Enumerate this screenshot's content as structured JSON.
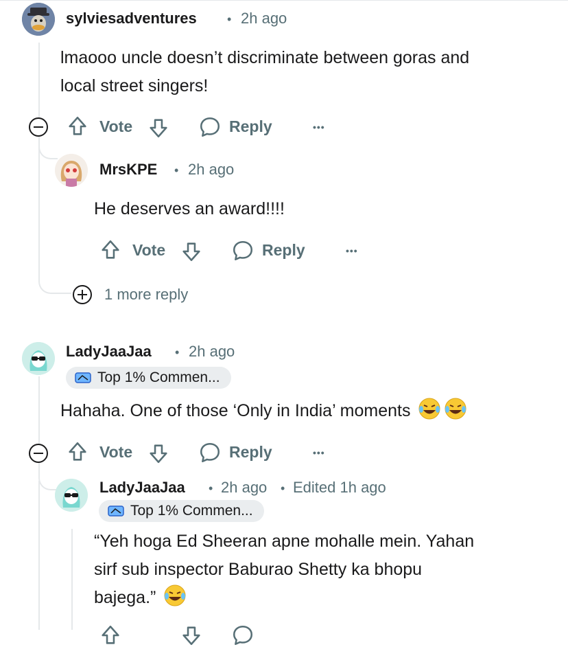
{
  "comments": [
    {
      "username": "sylviesadventures",
      "time": "2h ago",
      "body_lines": [
        "lmaooo uncle doesn’t discriminate between goras and",
        "local street singers!"
      ],
      "actions": {
        "vote": "Vote",
        "reply": "Reply"
      }
    },
    {
      "username": "MrsKPE",
      "time": "2h ago",
      "body_lines": [
        "He deserves an award!!!!"
      ],
      "actions": {
        "vote": "Vote",
        "reply": "Reply"
      },
      "more_replies": "1 more reply"
    },
    {
      "username": "LadyJaaJaa",
      "time": "2h ago",
      "flair": "Top 1% Commen...",
      "body_lines": [
        "Hahaha. One of those ‘Only in India’ moments"
      ],
      "actions": {
        "vote": "Vote",
        "reply": "Reply"
      }
    },
    {
      "username": "LadyJaaJaa",
      "time": "2h ago",
      "edited": "Edited 1h ago",
      "flair": "Top 1% Commen...",
      "body_lines": [
        "“Yeh hoga Ed Sheeran apne mohalle mein. Yahan",
        "sirf sub inspector Baburao Shetty ka bhopu",
        "bajega.”"
      ]
    }
  ],
  "separator": "•",
  "more_label": "•••",
  "colors": {
    "meta": "#576f76",
    "text": "#1a1a1b",
    "thread": "#e5e8ea",
    "flair_bg": "#eaedef"
  }
}
